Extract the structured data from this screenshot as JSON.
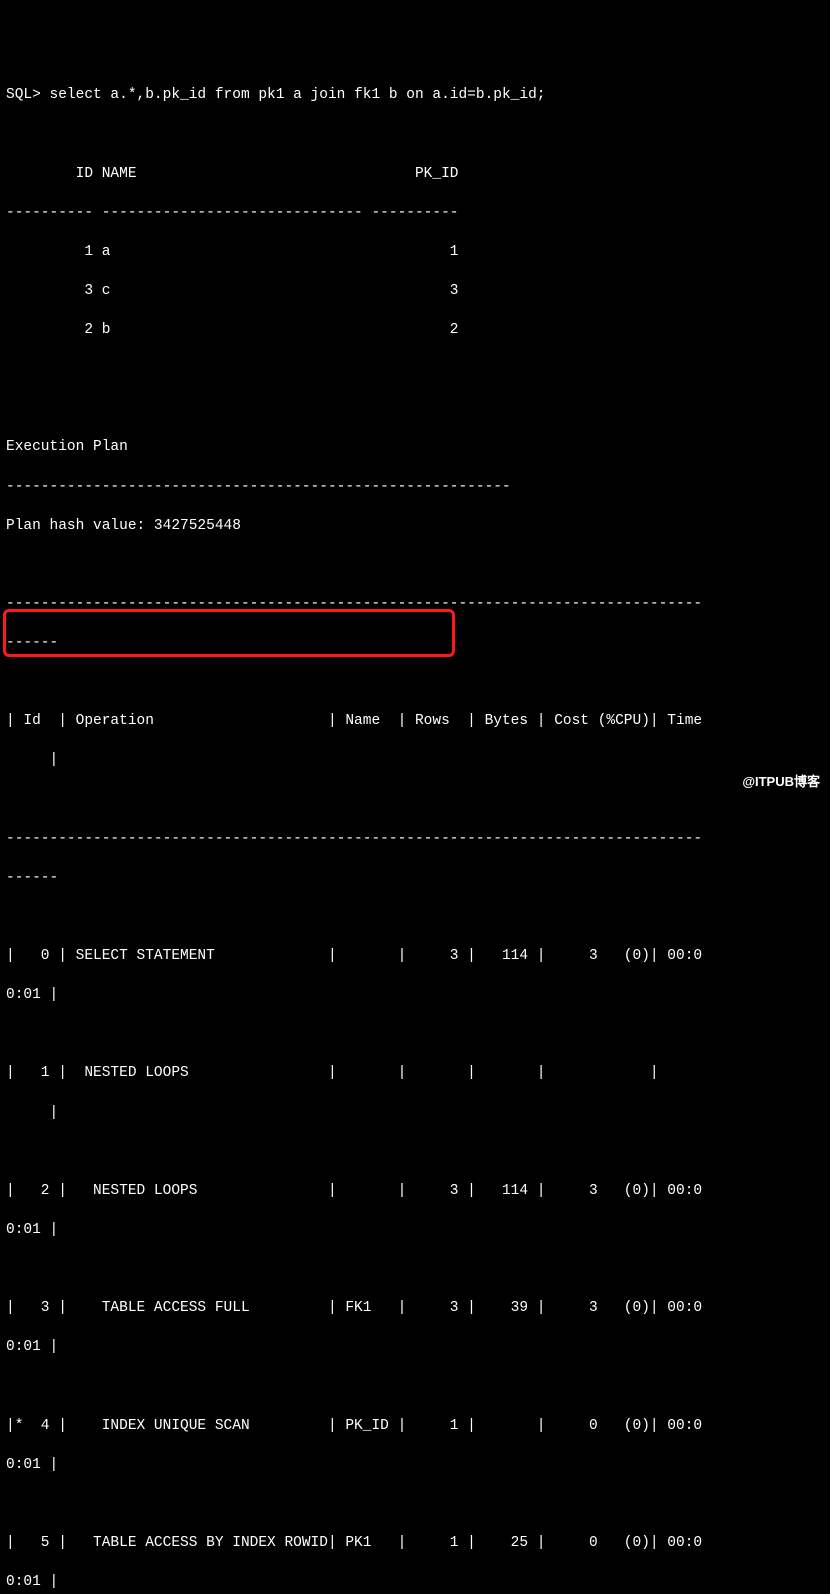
{
  "prompt": "SQL> select a.*,b.pk_id from pk1 a join fk1 b on a.id=b.pk_id;",
  "result_header": "        ID NAME                                PK_ID",
  "result_sep": "---------- ------------------------------ ----------",
  "result_rows": [
    "         1 a                                       1",
    "         3 c                                       3",
    "         2 b                                       2"
  ],
  "exec_plan_title": "Execution Plan",
  "exec_plan_sep": "----------------------------------------------------------",
  "plan_hash": "Plan hash value: 3427525448",
  "long_dash": "--------------------------------------------------------------------------------",
  "short_dash": "------",
  "plan_header1": "| Id  | Operation                    | Name  | Rows  | Bytes | Cost (%CPU)| Time",
  "plan_header2": "     |",
  "plan_rows": [
    {
      "a": "|   0 | SELECT STATEMENT             |       |     3 |   114 |     3   (0)| 00:0",
      "b": "0:01 |"
    },
    {
      "a": "|   1 |  NESTED LOOPS                |       |       |       |            |",
      "b": "     |"
    },
    {
      "a": "|   2 |   NESTED LOOPS               |       |     3 |   114 |     3   (0)| 00:0",
      "b": "0:01 |"
    },
    {
      "a": "|   3 |    TABLE ACCESS FULL         | FK1   |     3 |    39 |     3   (0)| 00:0",
      "b": "0:01 |"
    },
    {
      "a": "|*  4 |    INDEX UNIQUE SCAN         | PK_ID |     1 |       |     0   (0)| 00:0",
      "b": "0:01 |"
    },
    {
      "a": "|   5 |   TABLE ACCESS BY INDEX ROWID| PK1   |     1 |    25 |     0   (0)| 00:0",
      "b": "0:01 |"
    }
  ],
  "watermark": "@ITPUB博客",
  "chart_data": {
    "type": "table",
    "title": "Execution Plan",
    "plan_hash_value": 3427525448,
    "query_result": {
      "columns": [
        "ID",
        "NAME",
        "PK_ID"
      ],
      "rows": [
        [
          1,
          "a",
          1
        ],
        [
          3,
          "c",
          3
        ],
        [
          2,
          "b",
          2
        ]
      ]
    },
    "plan_columns": [
      "Id",
      "Operation",
      "Name",
      "Rows",
      "Bytes",
      "Cost (%CPU)",
      "Time"
    ],
    "plan_rows": [
      {
        "Id": 0,
        "Operation": "SELECT STATEMENT",
        "Name": "",
        "Rows": 3,
        "Bytes": 114,
        "Cost": 3,
        "CPU%": 0,
        "Time": "00:00:01"
      },
      {
        "Id": 1,
        "Operation": " NESTED LOOPS",
        "Name": "",
        "Rows": null,
        "Bytes": null,
        "Cost": null,
        "CPU%": null,
        "Time": ""
      },
      {
        "Id": 2,
        "Operation": "  NESTED LOOPS",
        "Name": "",
        "Rows": 3,
        "Bytes": 114,
        "Cost": 3,
        "CPU%": 0,
        "Time": "00:00:01"
      },
      {
        "Id": 3,
        "Operation": "   TABLE ACCESS FULL",
        "Name": "FK1",
        "Rows": 3,
        "Bytes": 39,
        "Cost": 3,
        "CPU%": 0,
        "Time": "00:00:01",
        "highlighted": true
      },
      {
        "Id": 4,
        "predicate": true,
        "Operation": "   INDEX UNIQUE SCAN",
        "Name": "PK_ID",
        "Rows": 1,
        "Bytes": null,
        "Cost": 0,
        "CPU%": 0,
        "Time": "00:00:01"
      },
      {
        "Id": 5,
        "Operation": "  TABLE ACCESS BY INDEX ROWID",
        "Name": "PK1",
        "Rows": 1,
        "Bytes": 25,
        "Cost": 0,
        "CPU%": 0,
        "Time": "00:00:01"
      }
    ]
  }
}
